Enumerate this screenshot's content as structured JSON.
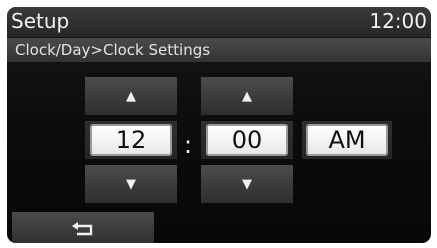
{
  "header": {
    "title": "Setup",
    "clock": "12:00"
  },
  "breadcrumb": "Clock/Day>Clock Settings",
  "time": {
    "hour": "12",
    "separator": ":",
    "minute": "00",
    "period": "AM"
  },
  "icons": {
    "up": "up-arrow-icon",
    "down": "down-arrow-icon",
    "back": "return-arrow-icon"
  },
  "colors": {
    "background": "#0c0c0c",
    "bar": "#2e2e2e",
    "value_box": "#ffffff",
    "text": "#f2f2f2"
  }
}
